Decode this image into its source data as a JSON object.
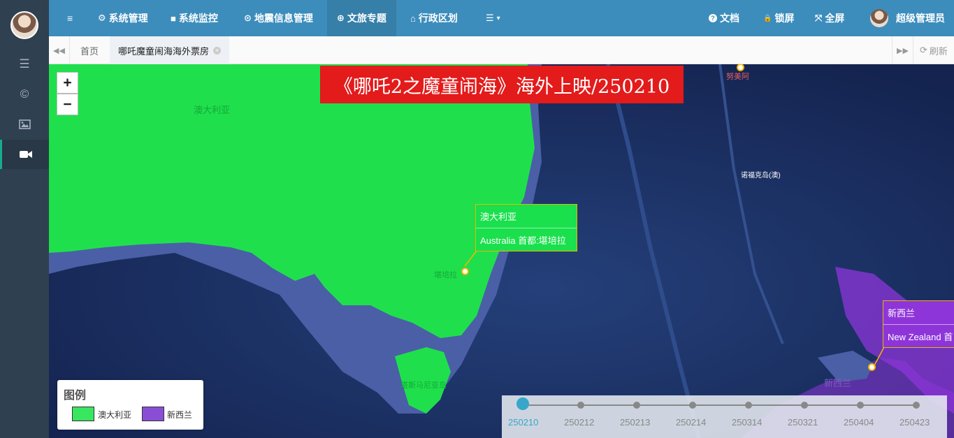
{
  "sidebar": {
    "avatar": "avatar",
    "items": [
      {
        "icon": "menu-icon"
      },
      {
        "icon": "copyright-icon"
      },
      {
        "icon": "image-icon"
      },
      {
        "icon": "video-camera-icon",
        "active": true
      }
    ]
  },
  "topnav": {
    "toggle_icon": "≡",
    "items": [
      {
        "icon": "⚙",
        "label": "系统管理"
      },
      {
        "icon": "■",
        "label": "系统监控"
      },
      {
        "icon": "⊙",
        "label": "地震信息管理"
      },
      {
        "icon": "⊕",
        "label": "文旅专题",
        "active": true
      },
      {
        "icon": "⌂",
        "label": "行政区划"
      },
      {
        "icon": "☰",
        "label": "▾"
      }
    ],
    "right": {
      "docs": {
        "icon": "?",
        "label": "文档"
      },
      "lock": {
        "icon": "🔒",
        "label": "锁屏"
      },
      "fullscreen": {
        "icon": "⤧",
        "label": "全屏"
      },
      "user": {
        "label": "超级管理员"
      }
    }
  },
  "tabs": {
    "back_icon": "◀◀",
    "forward_icon": "▶▶",
    "items": [
      {
        "label": "首页"
      },
      {
        "label": "哪吒魔童闹海海外票房",
        "active": true,
        "close": "×"
      }
    ],
    "refresh": {
      "icon": "⟳",
      "label": "刷新"
    }
  },
  "map": {
    "zoom_in": "+",
    "zoom_out": "−",
    "title": "《哪吒2之魔童闹海》海外上映/250210",
    "labels": {
      "australia": "澳大利亚",
      "norfolk": "诺福克岛(澳)",
      "noumea": "努美阿",
      "canberra": "堪培拉",
      "tasmania": "塔斯马尼亚岛",
      "newzealand": "新西兰"
    },
    "popups": [
      {
        "title": "澳大利亚",
        "detail": "Australia 首都:堪培拉",
        "color": "#19e04c"
      },
      {
        "title": "新西兰",
        "detail": "New Zealand 首",
        "color": "#8e35d9"
      }
    ],
    "colors": {
      "ocean": "#1d2f66",
      "australia_fill": "#1fe04c",
      "newzealand_fill": "#8e35d9"
    }
  },
  "legend": {
    "title": "图例",
    "items": [
      {
        "label": "澳大利亚",
        "color": "#39e660"
      },
      {
        "label": "新西兰",
        "color": "#8a4ed6"
      }
    ]
  },
  "timeline": {
    "current": "250210",
    "dates": [
      "250210",
      "250212",
      "250213",
      "250214",
      "250314",
      "250321",
      "250404",
      "250423"
    ]
  }
}
